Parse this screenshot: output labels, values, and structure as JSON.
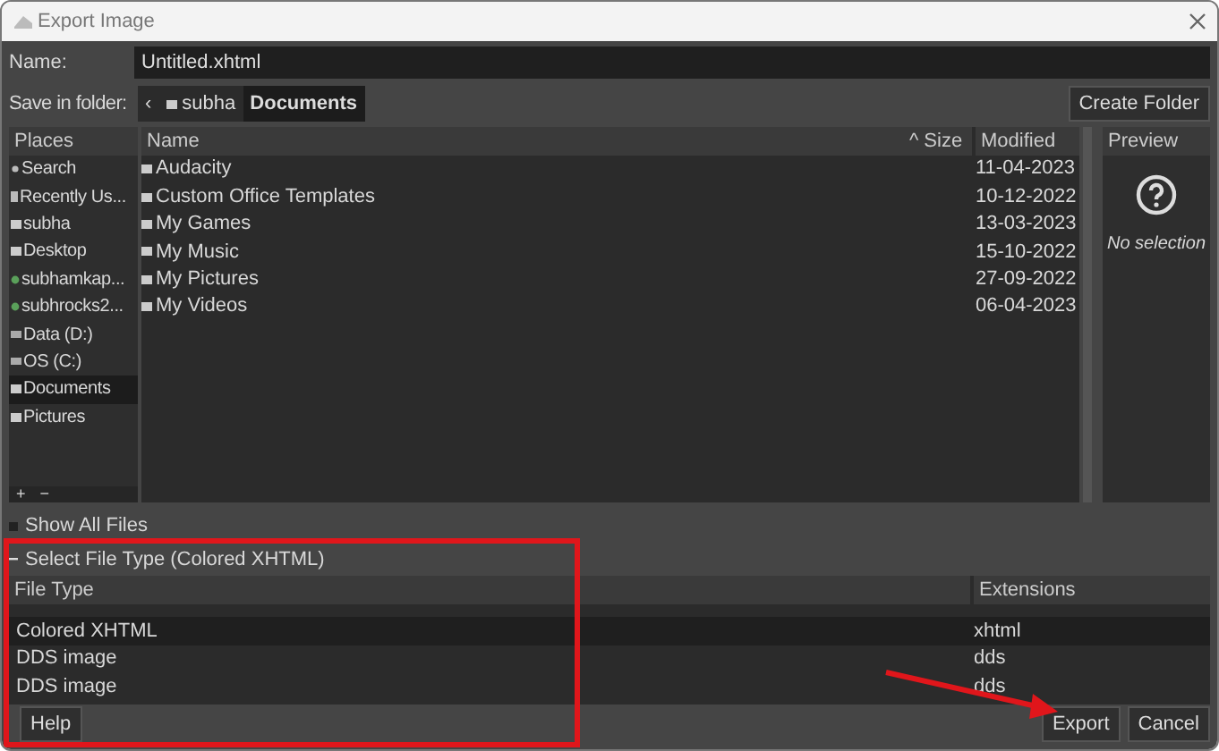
{
  "window": {
    "title": "Export Image"
  },
  "name_field": {
    "label": "Name:",
    "value": "Untitled.xhtml"
  },
  "save_in": {
    "label": "Save in folder:",
    "back": "‹",
    "path": [
      {
        "label": "subha",
        "selected": false,
        "folder_icon": true
      },
      {
        "label": "Documents",
        "selected": true,
        "folder_icon": false
      }
    ]
  },
  "create_folder": "Create Folder",
  "places": {
    "heading": "Places",
    "items": [
      {
        "label": "Search",
        "kind": "search",
        "selected": false
      },
      {
        "label": "Recently Us...",
        "kind": "recent",
        "selected": false
      },
      {
        "label": "subha",
        "kind": "folder",
        "selected": false
      },
      {
        "label": "Desktop",
        "kind": "folder",
        "selected": false
      },
      {
        "label": "subhamkap...",
        "kind": "network",
        "selected": false
      },
      {
        "label": "subhrocks2...",
        "kind": "network",
        "selected": false
      },
      {
        "label": "Data (D:)",
        "kind": "drive",
        "selected": false
      },
      {
        "label": "OS (C:)",
        "kind": "drive",
        "selected": false
      },
      {
        "label": "Documents",
        "kind": "folder",
        "selected": true
      },
      {
        "label": "Pictures",
        "kind": "folder",
        "selected": false
      }
    ],
    "add": "+",
    "remove": "−"
  },
  "files": {
    "columns": [
      "Name",
      "Size",
      "Modified"
    ],
    "sort_mark": "^",
    "rows": [
      {
        "name": "Audacity",
        "modified": "11-04-2023"
      },
      {
        "name": "Custom Office Templates",
        "modified": "10-12-2022"
      },
      {
        "name": "My Games",
        "modified": "13-03-2023"
      },
      {
        "name": "My Music",
        "modified": "15-10-2022"
      },
      {
        "name": "My Pictures",
        "modified": "27-09-2022"
      },
      {
        "name": "My Videos",
        "modified": "06-04-2023"
      }
    ]
  },
  "preview": {
    "heading": "Preview",
    "message": "No selection"
  },
  "show_all_files": {
    "label": "Show All Files",
    "checked": false
  },
  "file_type": {
    "label": "Select File Type (Colored XHTML)",
    "expanded": true,
    "columns": [
      "File Type",
      "Extensions"
    ],
    "rows": [
      {
        "type": "Colored XHTML",
        "ext": "xhtml",
        "selected": true
      },
      {
        "type": "DDS image",
        "ext": "dds",
        "selected": false
      },
      {
        "type": "DDS image",
        "ext": "dds",
        "selected": false
      }
    ]
  },
  "buttons": {
    "help": "Help",
    "export": "Export",
    "cancel": "Cancel"
  }
}
